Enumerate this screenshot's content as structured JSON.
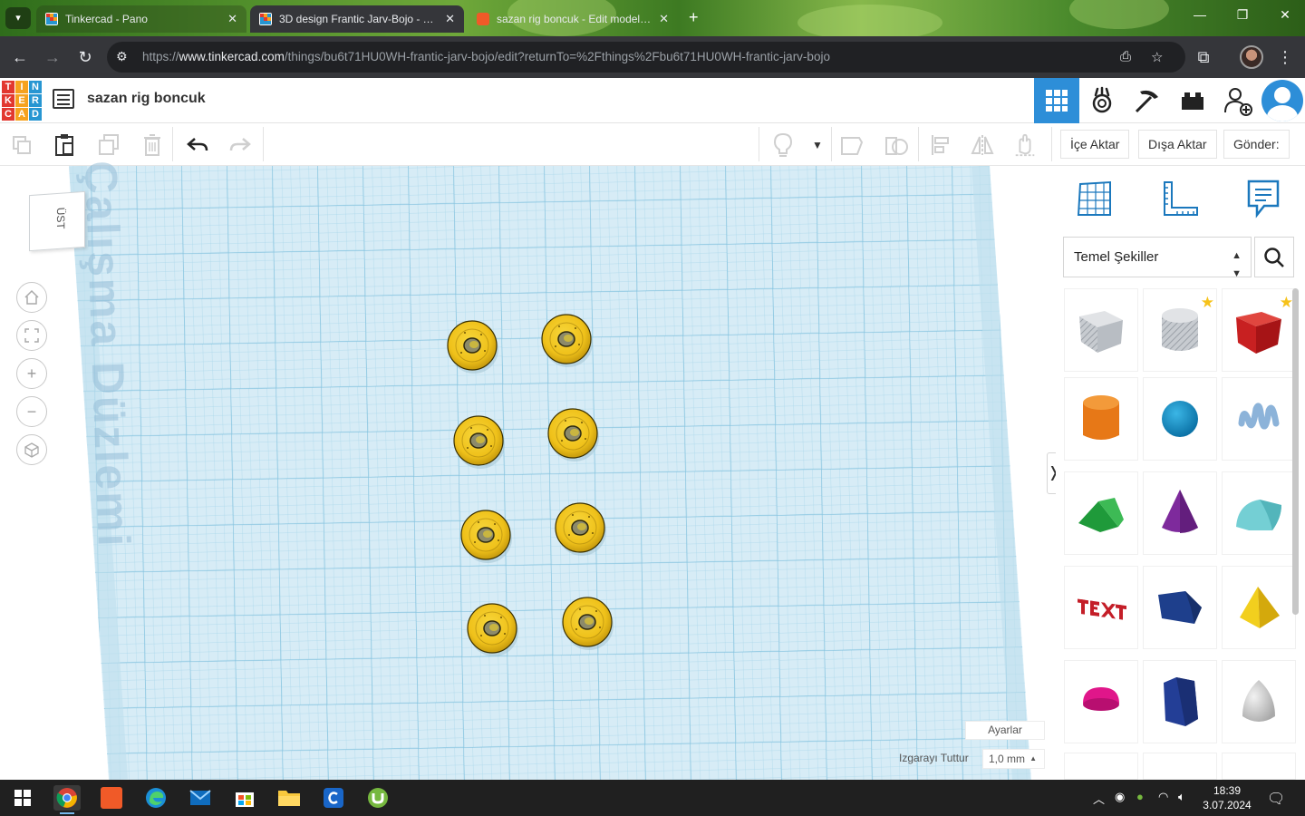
{
  "browser": {
    "tabs": [
      {
        "title": "Tinkercad - Pano",
        "active": false,
        "favicon": "tinkercad-favicon"
      },
      {
        "title": "3D design Frantic Jarv-Bojo - Tinkercad",
        "active": true,
        "favicon": "tinkercad-favicon"
      },
      {
        "title": "sazan rig boncuk - Edit model | Tinkercad",
        "active": false,
        "favicon": "ratings-favicon"
      }
    ],
    "new_tab_icon": "plus-icon",
    "url_prefix": "https://",
    "url_domain": "www.tinkercad.com",
    "url_path": "/things/bu6t71HU0WH-frantic-jarv-bojo/edit?returnTo=%2Fthings%2Fbu6t71HU0WH-frantic-jarv-bojo"
  },
  "app": {
    "logo_letters": [
      "T",
      "I",
      "N",
      "K",
      "E",
      "R",
      "C",
      "A",
      "D"
    ],
    "logo_colors": [
      "#e2382f",
      "#f6a21e",
      "#2796d2",
      "#e2382f",
      "#f6a21e",
      "#2796d2",
      "#e2382f",
      "#f6a21e",
      "#2796d2"
    ],
    "design_title": "sazan rig boncuk",
    "accent": "#2d8ed8"
  },
  "toolbar": {
    "import_label": "İçe Aktar",
    "export_label": "Dışa Aktar",
    "send_label": "Gönder:"
  },
  "workplane": {
    "plane_label": "Çalışma Düzlemi",
    "view_cube_label": "ÜST",
    "settings_label": "Ayarlar",
    "snap_label": "Izgarayı Tuttur",
    "snap_value": "1,0 mm",
    "bead_color": "#f2c318",
    "grid_bg": "#d7ecf6",
    "grid_line": "#9ccfe5"
  },
  "panel": {
    "library_select": "Temel Şekiller",
    "shapes": [
      {
        "name": "box-hole",
        "favorite": false
      },
      {
        "name": "cylinder-hole",
        "favorite": true
      },
      {
        "name": "box",
        "favorite": true
      },
      {
        "name": "cylinder",
        "favorite": false
      },
      {
        "name": "sphere",
        "favorite": false
      },
      {
        "name": "scribble",
        "favorite": false
      },
      {
        "name": "roof",
        "favorite": false
      },
      {
        "name": "cone",
        "favorite": false
      },
      {
        "name": "round-roof",
        "favorite": false
      },
      {
        "name": "text",
        "favorite": false
      },
      {
        "name": "polygon",
        "favorite": false
      },
      {
        "name": "pyramid",
        "favorite": false
      },
      {
        "name": "half-sphere",
        "favorite": false
      },
      {
        "name": "hexagonal-prism",
        "favorite": false
      },
      {
        "name": "paraboloid",
        "favorite": false
      }
    ]
  },
  "taskbar": {
    "time": "18:39",
    "date": "3.07.2024"
  }
}
